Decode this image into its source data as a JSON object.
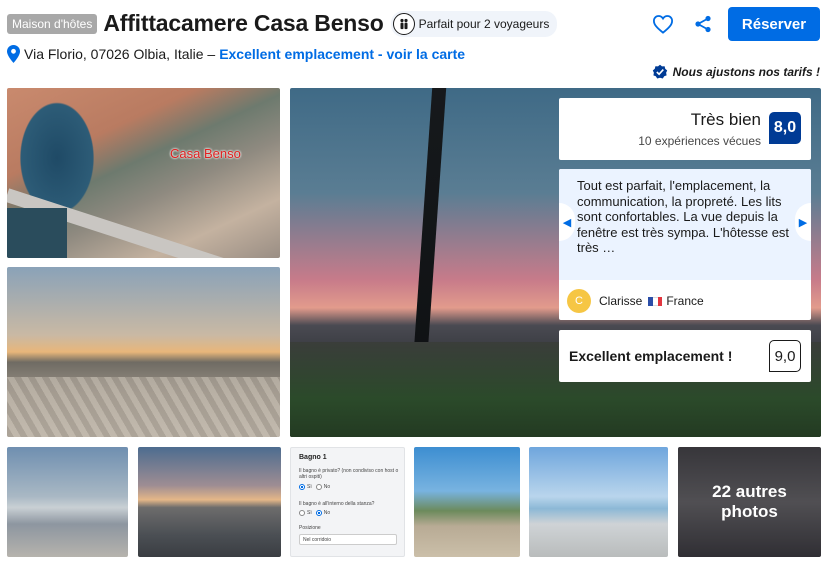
{
  "header": {
    "badge": "Maison d'hôtes",
    "title": "Affittacamere Casa Benso",
    "capacity": "Parfait pour 2 voyageurs"
  },
  "actions": {
    "favorite_icon": "heart-icon",
    "share_icon": "share-icon",
    "reserve_label": "Réserver"
  },
  "address": {
    "text": "Via Florio, 07026 Olbia, Italie –",
    "link": "Excellent emplacement - voir la carte"
  },
  "tarifs": "Nous ajustons nos tarifs !",
  "gallery": {
    "aerial_label": "Casa Benso",
    "more_line1": "22 autres",
    "more_line2": "photos"
  },
  "score": {
    "label": "Très bien",
    "count": "10 expériences vécues",
    "value": "8,0"
  },
  "review": {
    "text": "Tout est parfait, l'emplacement, la communication, la propreté. Les lits sont confortables. La vue depuis la fenêtre est très sympa. L'hôtesse est très …",
    "avatar_initial": "C",
    "reviewer": "Clarisse",
    "country": "France"
  },
  "location": {
    "label": "Excellent emplacement !",
    "value": "9,0"
  },
  "form_thumb": {
    "title": "Bagno 1",
    "q1": "Il bagno è privato? (non condiviso con host o altri ospiti)",
    "q1_yes": "Sì",
    "q1_no": "No",
    "q2": "Il bagno è all'interno della stanza?",
    "q2_yes": "Sì",
    "q2_no": "No",
    "position_label": "Posizione",
    "position_value": "Nel corridoio"
  },
  "colors": {
    "primary": "#006ce4",
    "score_bg": "#003b95",
    "review_bg": "#ebf3ff"
  }
}
